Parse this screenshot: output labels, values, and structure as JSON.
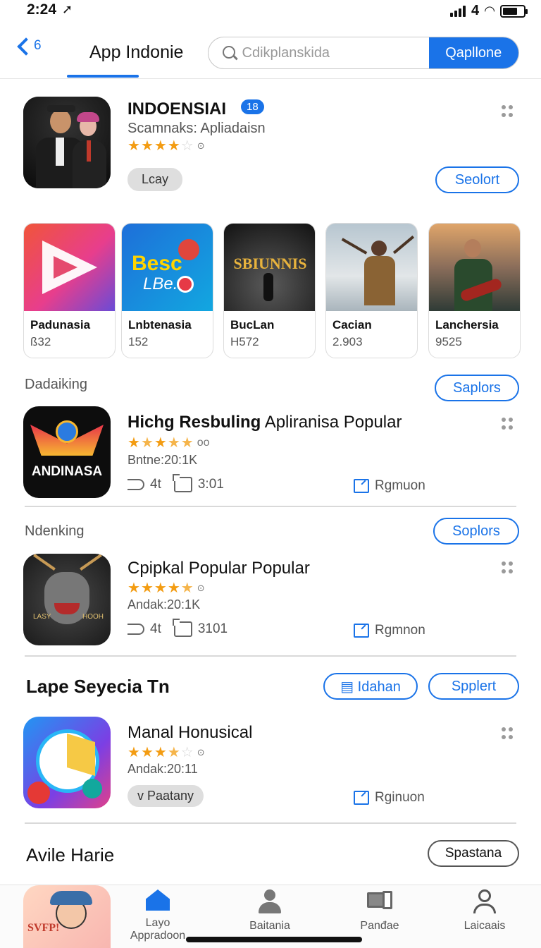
{
  "status": {
    "time": "2:24",
    "network": "4"
  },
  "header": {
    "back_count": "6",
    "title": "App Indonie",
    "search_placeholder": "Cdikplanskida",
    "search_button": "Qapllone"
  },
  "featured": {
    "name": "INDOENSIAI",
    "badge": "18",
    "subtitle": "Scamnaks: Apliadaisn",
    "rating": 4.5,
    "tag": "Lcay",
    "action": "Seolort"
  },
  "cards": [
    {
      "title": "Padunasia",
      "count": "ß32"
    },
    {
      "title": "Lnbtenasia",
      "count": "152",
      "art_text_1": "Besc",
      "art_text_2": "LBe."
    },
    {
      "title": "BucLan",
      "count": "H572",
      "art_text_1": "SBIUNNIS"
    },
    {
      "title": "Cacian",
      "count": "2.903"
    },
    {
      "title": "Lanchersia",
      "count": "9525"
    }
  ],
  "section1": {
    "label": "Dadaiking",
    "action": "Saplors"
  },
  "item1": {
    "icon_text": "ANDINASA",
    "title_bold": "Hichg Resbuling",
    "title_rest": " Apliranisa Popular",
    "rating_suffix": "oo",
    "meta": "Bntne:20:1K",
    "share_count": "4t",
    "comment_count": "3:01",
    "open_label": "Rgmuon"
  },
  "section2": {
    "label": "Ndenking",
    "action": "Soplors"
  },
  "item2": {
    "icon_text": "LASY",
    "icon_text_2": "HOOH",
    "title": "Cpipkal Popular Popular",
    "meta": "Andak:20:1K",
    "share_count": "4t",
    "comment_count": "3101",
    "open_label": "Rgmnon"
  },
  "section3": {
    "heading": "Lape Seyecia Tn",
    "action1": "Idahan",
    "action2": "Spplert"
  },
  "item3": {
    "title": "Manal Honusical",
    "meta": "Andak:20:11",
    "tag": "v Paatany",
    "open_label": "Rginuon"
  },
  "section4": {
    "heading": "Avile Harie",
    "action": "Spastana"
  },
  "bottom_nav": {
    "avatar_text": "SVFP!",
    "items": [
      {
        "label": "Layo",
        "sub": "Appradoon"
      },
      {
        "label": "Baitania",
        "sub": ""
      },
      {
        "label": "Panđae",
        "sub": ""
      },
      {
        "label": "Laicaais",
        "sub": ""
      }
    ]
  },
  "colors": {
    "accent": "#1a73e8",
    "star": "#f39c12"
  }
}
